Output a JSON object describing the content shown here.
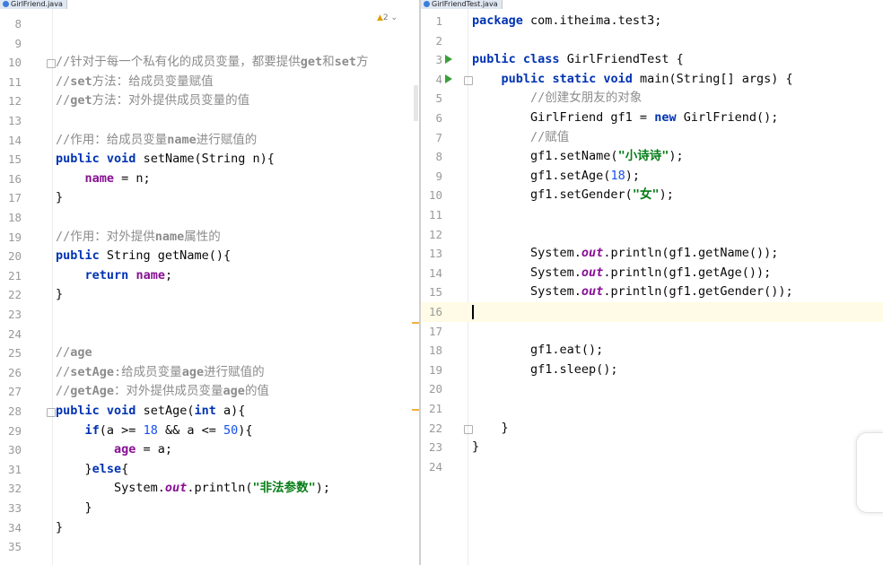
{
  "left_editor": {
    "tab_label": "GirlFriend.java",
    "inspection_count": "2",
    "lines": [
      {
        "n": "8"
      },
      {
        "n": "9"
      },
      {
        "n": "10",
        "text": "//针对于每一个私有化的成员变量，都要提供get和set方"
      },
      {
        "n": "11",
        "text": "//set方法：给成员变量赋值"
      },
      {
        "n": "12",
        "text": "//get方法：对外提供成员变量的值"
      },
      {
        "n": "13"
      },
      {
        "n": "14",
        "text": "//作用：给成员变量name进行赋值的"
      },
      {
        "n": "15",
        "text": "public void setName(String n){"
      },
      {
        "n": "16",
        "text": "    name = n;"
      },
      {
        "n": "17",
        "text": "}"
      },
      {
        "n": "18"
      },
      {
        "n": "19",
        "text": "//作用：对外提供name属性的"
      },
      {
        "n": "20",
        "text": "public String getName(){"
      },
      {
        "n": "21",
        "text": "    return name;"
      },
      {
        "n": "22",
        "text": "}"
      },
      {
        "n": "23"
      },
      {
        "n": "24"
      },
      {
        "n": "25",
        "text": "//age"
      },
      {
        "n": "26",
        "text": "//setAge:给成员变量age进行赋值的"
      },
      {
        "n": "27",
        "text": "//getAge：对外提供成员变量age的值"
      },
      {
        "n": "28",
        "text": "public void setAge(int a){"
      },
      {
        "n": "29",
        "text": "    if(a >= 18 && a <= 50){"
      },
      {
        "n": "30",
        "text": "        age = a;"
      },
      {
        "n": "31",
        "text": "    }else{"
      },
      {
        "n": "32",
        "text": "        System.out.println(\"非法参数\");"
      },
      {
        "n": "33",
        "text": "    }"
      },
      {
        "n": "34",
        "text": "}"
      },
      {
        "n": "35"
      }
    ]
  },
  "right_editor": {
    "tab_label": "GirlFriendTest.java",
    "lines": [
      {
        "n": "1",
        "text": "package com.itheima.test3;"
      },
      {
        "n": "2"
      },
      {
        "n": "3",
        "text": "public class GirlFriendTest {"
      },
      {
        "n": "4",
        "text": "    public static void main(String[] args) {"
      },
      {
        "n": "5",
        "text": "        //创建女朋友的对象"
      },
      {
        "n": "6",
        "text": "        GirlFriend gf1 = new GirlFriend();"
      },
      {
        "n": "7",
        "text": "        //赋值"
      },
      {
        "n": "8",
        "text": "        gf1.setName(\"小诗诗\");"
      },
      {
        "n": "9",
        "text": "        gf1.setAge(18);"
      },
      {
        "n": "10",
        "text": "        gf1.setGender(\"女\");"
      },
      {
        "n": "11"
      },
      {
        "n": "12"
      },
      {
        "n": "13",
        "text": "        System.out.println(gf1.getName());"
      },
      {
        "n": "14",
        "text": "        System.out.println(gf1.getAge());"
      },
      {
        "n": "15",
        "text": "        System.out.println(gf1.getGender());"
      },
      {
        "n": "16"
      },
      {
        "n": "17"
      },
      {
        "n": "18",
        "text": "        gf1.eat();"
      },
      {
        "n": "19",
        "text": "        gf1.sleep();"
      },
      {
        "n": "20"
      },
      {
        "n": "21"
      },
      {
        "n": "22",
        "text": "    }"
      },
      {
        "n": "23",
        "text": "}"
      },
      {
        "n": "24"
      }
    ]
  }
}
